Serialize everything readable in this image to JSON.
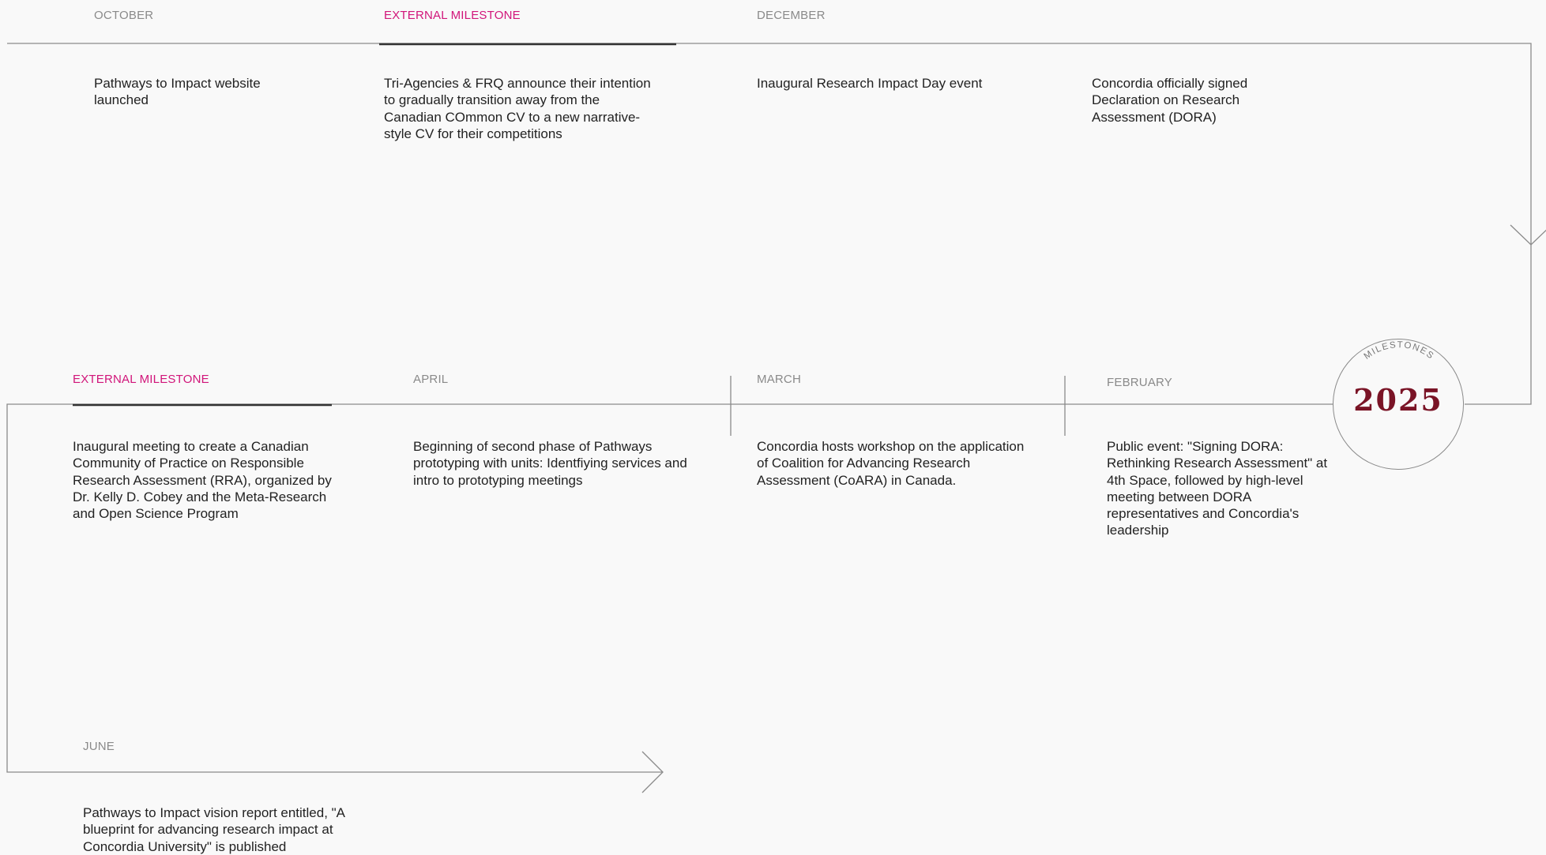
{
  "badge": {
    "arc_text": "MILESTONES",
    "year": "2025"
  },
  "row1": [
    {
      "label": "OCTOBER",
      "external": false,
      "text": "Pathways to Impact website launched"
    },
    {
      "label": "EXTERNAL MILESTONE",
      "external": true,
      "text": "Tri-Agencies & FRQ announce their intention to gradually transition away from the Canadian COmmon CV to a new narrative-style CV for their competitions"
    },
    {
      "label": "DECEMBER",
      "external": false,
      "text": "Inaugural Research Impact Day event"
    },
    {
      "label": "",
      "external": false,
      "text": "Concordia officially signed Declaration on Research Assessment (DORA)"
    }
  ],
  "row2": [
    {
      "label": "EXTERNAL MILESTONE",
      "external": true,
      "text": "Inaugural meeting to create a Canadian Community of Practice on Responsible Research Assessment (RRA), organized by Dr. Kelly D. Cobey and the Meta-Research and Open Science Program"
    },
    {
      "label": "APRIL",
      "external": false,
      "text": "Beginning of second phase of Pathways prototyping with units: Identfiying services and intro to prototyping meetings"
    },
    {
      "label": "MARCH",
      "external": false,
      "text": "Concordia hosts workshop on the application of Coalition for Advancing Research Assessment (CoARA) in Canada."
    },
    {
      "label": "FEBRUARY",
      "external": false,
      "text": "Public event: \"Signing DORA: Rethinking Research Assessment\" at 4th Space, followed by high-level meeting between DORA representatives and Concordia's leadership"
    }
  ],
  "row3": [
    {
      "label": "JUNE",
      "external": false,
      "text": "Pathways to Impact vision report entitled, \"A blueprint for advancing research impact at Concordia University\" is published"
    }
  ],
  "colors": {
    "accent": "#d1157a",
    "year": "#7a1426",
    "line": "#8a8a8a"
  }
}
